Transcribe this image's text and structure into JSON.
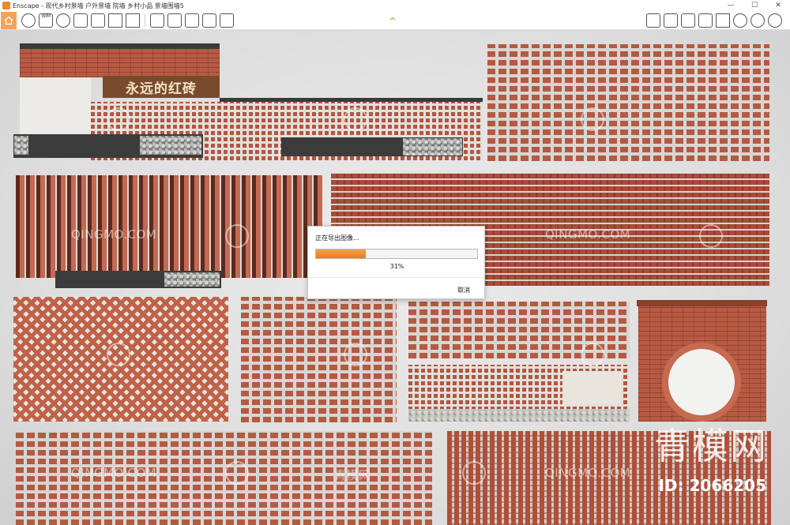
{
  "window": {
    "title": "Enscape - 现代乡村景墙 户外景墙 院墙 乡村小品 景墙围墙5",
    "controls": {
      "minimize": "—",
      "maximize": "☐",
      "close": "✕"
    }
  },
  "toolbar": {
    "bim_label": "BIM",
    "collapse_glyph": "^",
    "left_icons": [
      "home-icon",
      "materials-icon",
      "bim-icon",
      "binoculars-icon",
      "asset-icon",
      "light-icon",
      "building-icon",
      "clapboard-icon",
      "screenshot-icon",
      "batch-render-icon",
      "video-export-icon",
      "panorama-icon",
      "export-icon"
    ],
    "right_icons": [
      "book-icon",
      "visual-settings-icon",
      "views-icon",
      "cube-icon",
      "m-icon",
      "sync-icon",
      "settings-icon",
      "help-icon"
    ]
  },
  "viewport": {
    "sign_text": "永远的红砖",
    "watermark_text": "QINGMO.COM",
    "watermark_cn": "青模网",
    "big_watermark": "青模网",
    "id_text": "ID: 2066205"
  },
  "dialog": {
    "title": "正在导出图像...",
    "progress": 31,
    "progress_label": "31%",
    "cancel_label": "取消",
    "accent": "#ec7a1c"
  }
}
